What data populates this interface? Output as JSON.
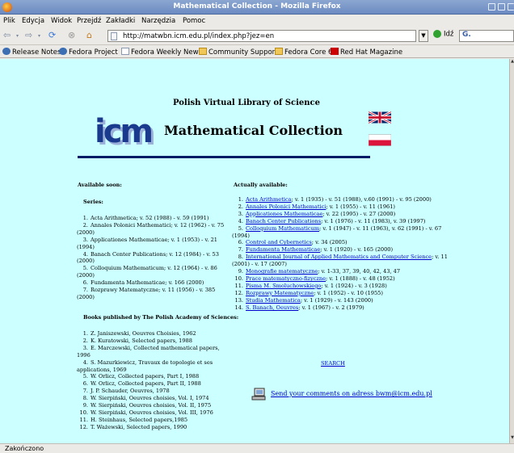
{
  "window": {
    "title": "Mathematical Collection - Mozilla Firefox"
  },
  "menu": [
    "Plik",
    "Edycja",
    "Widok",
    "Przejdź",
    "Zakładki",
    "Narzędzia",
    "Pomoc"
  ],
  "url": "http://matwbn.icm.edu.pl/index.php?jez=en",
  "go_label": "Idź",
  "search_glyph": "G.",
  "bookmarks": [
    "Release Notes",
    "Fedora Project",
    "Fedora Weekly News",
    "Community Support",
    "Fedora Core 6",
    "Red Hat Magazine"
  ],
  "status": "Zakończono",
  "page": {
    "logo": "icm",
    "subtitle": "Polish Virtual Library of Science",
    "title": "Mathematical Collection",
    "available_soon": "Available soon:",
    "series_heading": "Series:",
    "series": [
      "Acta Arithmetica; v. 52 (1988) - v. 59 (1991)",
      "Annales Polonici Mathematici; v. 12 (1962) - v. 75 (2000)",
      "Applicationes Mathematicae; v. 1 (1953) - v. 21 (1994)",
      "Banach Center Publications; v. 12 (1984) - v. 53 (2000)",
      "Colloquium Mathematicum; v. 12 (1964) - v. 86 (2000)",
      "Fundamenta Mathematicae; v. 166 (2000)",
      "Rozprawy Matematyczne; v. 11 (1956) - v. 385 (2000)"
    ],
    "books_heading": "Books published by The Polish Academy of Sciences:",
    "books": [
      "Z. Janiszewski, Oeuvres Choisies, 1962",
      "K. Kuratowski, Selected papers, 1988",
      "E. Marczewski, Collected mathematical papers, 1996",
      "S. Mazurkiewicz, Travaux de topologie et ses applications, 1969",
      "W. Orlicz, Collected papers, Part I, 1988",
      "W. Orlicz, Collected papers, Part II, 1988",
      "J. P. Schauder, Oeuvres, 1978",
      "W. Sierpiński, Oeuvres choisies, Vol. I, 1974",
      "W. Sierpiński, Oeuvres choisies, Vol. II, 1975",
      "W. Sierpiński, Oeuvres choisies, Vol. III, 1976",
      "H. Steinhaus, Selected papers,1985",
      "T. Ważewski, Selected papers, 1990"
    ],
    "actually_heading": "Actually available:",
    "available": [
      {
        "link": "Acta Arithmetica",
        "rest": "; v. 1 (1935) - v. 51 (1988), v.60 (1991) - v. 95 (2000)"
      },
      {
        "link": "Annales Polonici Mathematici",
        "rest": "; v. 1 (1955) - v. 11 (1961)"
      },
      {
        "link": "Applicationes Mathematicae",
        "rest": "; v. 22 (1995) - v. 27 (2000)"
      },
      {
        "link": "Banach Center Publications",
        "rest": "; v. 1 (1976) - v. 11 (1983), v. 39 (1997)"
      },
      {
        "link": "Colloquium Mathematicum",
        "rest": "; v. 1 (1947) - v. 11 (1963), v. 62 (1991) - v. 67 (1994)"
      },
      {
        "link": "Control and Cybernetics",
        "rest": "; v. 34 (2005)"
      },
      {
        "link": "Fundamenta Mathematicae",
        "rest": "; v. 1 (1920) - v. 165 (2000)"
      },
      {
        "link": "International Journal of Applied Mathematics and Computer Science",
        "rest": "; v. 11 (2001) - v. 17 (2007)"
      },
      {
        "link": "Monografie matematyczne",
        "rest": "; v. 1-33, 37, 39, 40, 42, 43, 47"
      },
      {
        "link": "Prace matematyczno-fizyczne",
        "rest": "; v. 1 (1888) - v. 48 (1952)"
      },
      {
        "link": "Pisma M. Smoluchowskiego",
        "rest": "; v. 1 (1924) - v. 3 (1928)"
      },
      {
        "link": "Rozprawy Matematyczne",
        "rest": "; v. 1 (1952) - v. 10 (1955)"
      },
      {
        "link": "Studia Mathematica",
        "rest": "; v. 1 (1929) - v. 143 (2000)"
      },
      {
        "link": "S. Banach, Oeuvres",
        "rest": "; v. 1 (1967) - v. 2 (1979)"
      }
    ],
    "search_link": "SEARCH",
    "comments_link": "Send your comments on adress bwm@icm.edu.pl"
  },
  "colors": {
    "page_bg": "#ccffff",
    "link": "#0000cc",
    "rule": "#001a66",
    "logo": "#1a3a8e"
  }
}
